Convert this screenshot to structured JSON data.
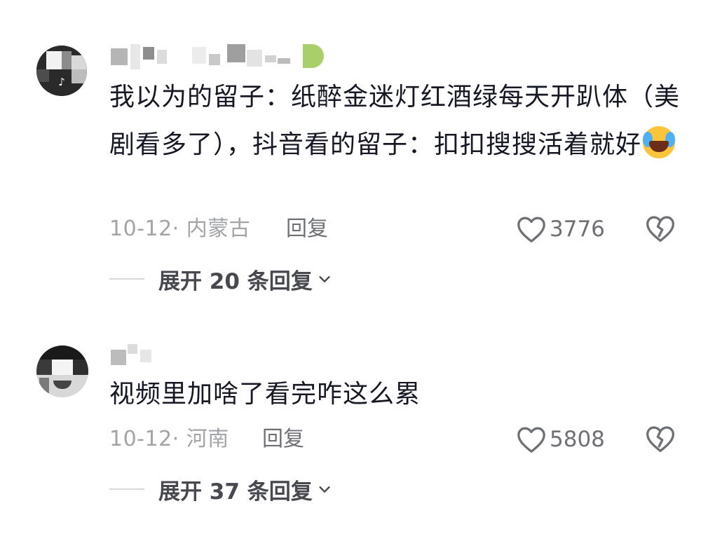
{
  "comments": [
    {
      "text": "我以为的留子：纸醉金迷灯红酒绿每天开趴体（美剧看多了），抖音看的留子：扣扣搜搜活着就好",
      "emoji_icon": "face-with-tears-of-joy-icon",
      "date_location": "10-12· 内蒙古",
      "reply_label": "回复",
      "like_count": "3776",
      "expand_label": "展开 20 条回复"
    },
    {
      "text": "视频里加啥了看完咋这么累",
      "date_location": "10-12· 河南",
      "reply_label": "回复",
      "like_count": "5808",
      "expand_label": "展开 37 条回复"
    }
  ],
  "colors": {
    "text_primary": "#161823",
    "text_meta": "#a3a4a8",
    "text_secondary": "#6e7075",
    "divider": "#d6d7da",
    "background": "#ffffff"
  },
  "icons": [
    "heart-outline-icon",
    "broken-heart-icon",
    "chevron-down-icon",
    "tiktok-logo-icon"
  ]
}
